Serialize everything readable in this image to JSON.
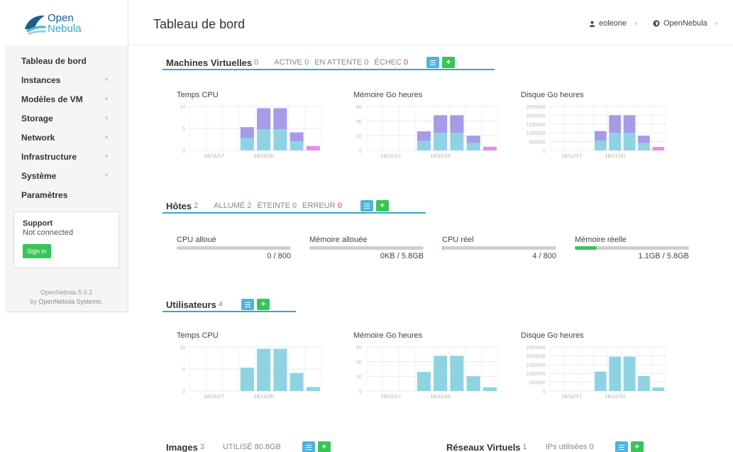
{
  "brand": {
    "logo_line1": "Open",
    "logo_line2": "Nebula"
  },
  "sidebar": {
    "items": [
      {
        "label": "Tableau de bord",
        "caret": false
      },
      {
        "label": "Instances",
        "caret": true
      },
      {
        "label": "Modèles de VM",
        "caret": true
      },
      {
        "label": "Storage",
        "caret": true
      },
      {
        "label": "Network",
        "caret": true
      },
      {
        "label": "Infrastructure",
        "caret": true
      },
      {
        "label": "Système",
        "caret": true
      },
      {
        "label": "Paramètres",
        "caret": false
      }
    ],
    "support": {
      "title": "Support",
      "status": "Not connected",
      "signin_label": "Sign in"
    },
    "version": "OpenNebula 5.0.2",
    "by_prefix": "by",
    "by_company": "OpenNebula Systems."
  },
  "topbar": {
    "title": "Tableau de bord",
    "user": "eoleone",
    "zone": "OpenNebula"
  },
  "vms": {
    "title": "Machines Virtuelles",
    "count": "0",
    "stats": [
      {
        "label": "ACTIVE",
        "value": "0",
        "color": "green"
      },
      {
        "label": "EN ATTENTE",
        "value": "0",
        "color": ""
      },
      {
        "label": "ÉCHEC",
        "value": "0",
        "color": "red"
      }
    ]
  },
  "hosts": {
    "title": "Hôtes",
    "count": "2",
    "stats": [
      {
        "label": "ALLUMÉ",
        "value": "2",
        "color": "green"
      },
      {
        "label": "ÉTEINTE",
        "value": "0",
        "color": ""
      },
      {
        "label": "ERREUR",
        "value": "0",
        "color": "red"
      }
    ],
    "gauges": [
      {
        "label": "CPU alloué",
        "value": "0 / 800",
        "fraction": 0
      },
      {
        "label": "Mémoire allouée",
        "value": "0KB / 5.8GB",
        "fraction": 0
      },
      {
        "label": "CPU réel",
        "value": "4 / 800",
        "fraction": 0.005
      },
      {
        "label": "Mémoire réelle",
        "value": "1.1GB / 5.8GB",
        "fraction": 0.19
      }
    ]
  },
  "users": {
    "title": "Utilisateurs",
    "count": "4"
  },
  "images": {
    "title": "Images",
    "count": "3",
    "stat_label": "UTILISÉ",
    "stat_value": "80.8GB"
  },
  "vnets": {
    "title": "Réseaux Virtuels",
    "count": "1",
    "stat_label": "IPs utilisées",
    "stat_value": "0"
  },
  "colors": {
    "accent": "#35a9c6",
    "green": "#38c557",
    "red": "#e53935",
    "bar_blue": "#8fd3e3",
    "bar_purple": "#a59be6",
    "bar_pink": "#e48fe8"
  },
  "chart_data": [
    {
      "type": "bar",
      "stacked": true,
      "title": "Temps CPU",
      "x_tick_labels": [
        "16/11/17",
        "16/11/20"
      ],
      "y_ticks": [
        "10",
        "5",
        "0"
      ],
      "ylim": [
        0,
        10
      ],
      "series": [
        {
          "color": "#8fd3e3",
          "values": [
            0,
            0,
            0,
            2.8,
            4.8,
            4.8,
            2.1,
            0
          ]
        },
        {
          "color": "#a59be6",
          "values": [
            0,
            0,
            0,
            2.5,
            4.8,
            4.8,
            2.0,
            0
          ]
        },
        {
          "color": "#e48fe8",
          "values": [
            0,
            0,
            0,
            0,
            0,
            0,
            0,
            1.0
          ]
        }
      ]
    },
    {
      "type": "bar",
      "stacked": true,
      "title": "Mémoire Go heures",
      "x_tick_labels": [
        "16/11/17",
        "16/11/20"
      ],
      "y_ticks": [
        "60",
        "40",
        "20",
        "0"
      ],
      "ylim": [
        0,
        60
      ],
      "series": [
        {
          "color": "#8fd3e3",
          "values": [
            0,
            0,
            0,
            13,
            24,
            24,
            10,
            0
          ]
        },
        {
          "color": "#a59be6",
          "values": [
            0,
            0,
            0,
            13,
            24,
            24,
            10,
            0
          ]
        },
        {
          "color": "#e48fe8",
          "values": [
            0,
            0,
            0,
            0,
            0,
            0,
            0,
            5
          ]
        }
      ]
    },
    {
      "type": "bar",
      "stacked": true,
      "title": "Disque Go heures",
      "x_tick_labels": [
        "16/11/17",
        "16/11/20"
      ],
      "y_ticks": [
        "2500000",
        "2000000",
        "1500000",
        "1000000",
        "500000",
        "0"
      ],
      "ylim": [
        0,
        2500000
      ],
      "series": [
        {
          "color": "#8fd3e3",
          "values": [
            0,
            0,
            0,
            550000,
            1000000,
            1000000,
            420000,
            0
          ]
        },
        {
          "color": "#a59be6",
          "values": [
            0,
            0,
            0,
            550000,
            1000000,
            1000000,
            420000,
            0
          ]
        },
        {
          "color": "#e48fe8",
          "values": [
            0,
            0,
            0,
            0,
            0,
            0,
            0,
            200000
          ]
        }
      ]
    },
    {
      "type": "bar",
      "stacked": false,
      "title": "Temps CPU",
      "x_tick_labels": [
        "16/11/17",
        "16/11/20"
      ],
      "y_ticks": [
        "10",
        "5",
        "0"
      ],
      "ylim": [
        0,
        10
      ],
      "series": [
        {
          "color": "#8fd3e3",
          "values": [
            0,
            0,
            0,
            5.3,
            9.6,
            9.6,
            4.1,
            0.9
          ]
        }
      ]
    },
    {
      "type": "bar",
      "stacked": false,
      "title": "Mémoire Go heures",
      "x_tick_labels": [
        "16/11/17",
        "16/11/20"
      ],
      "y_ticks": [
        "60",
        "40",
        "20",
        "0"
      ],
      "ylim": [
        0,
        60
      ],
      "series": [
        {
          "color": "#8fd3e3",
          "values": [
            0,
            0,
            0,
            26,
            48,
            48,
            20,
            5
          ]
        }
      ]
    },
    {
      "type": "bar",
      "stacked": false,
      "title": "Disque Go heures",
      "x_tick_labels": [
        "16/11/17",
        "16/11/20"
      ],
      "y_ticks": [
        "2500000",
        "2000000",
        "1500000",
        "1000000",
        "500000",
        "0"
      ],
      "ylim": [
        0,
        2500000
      ],
      "series": [
        {
          "color": "#8fd3e3",
          "values": [
            0,
            0,
            0,
            1100000,
            1950000,
            1950000,
            850000,
            200000
          ]
        }
      ]
    }
  ]
}
